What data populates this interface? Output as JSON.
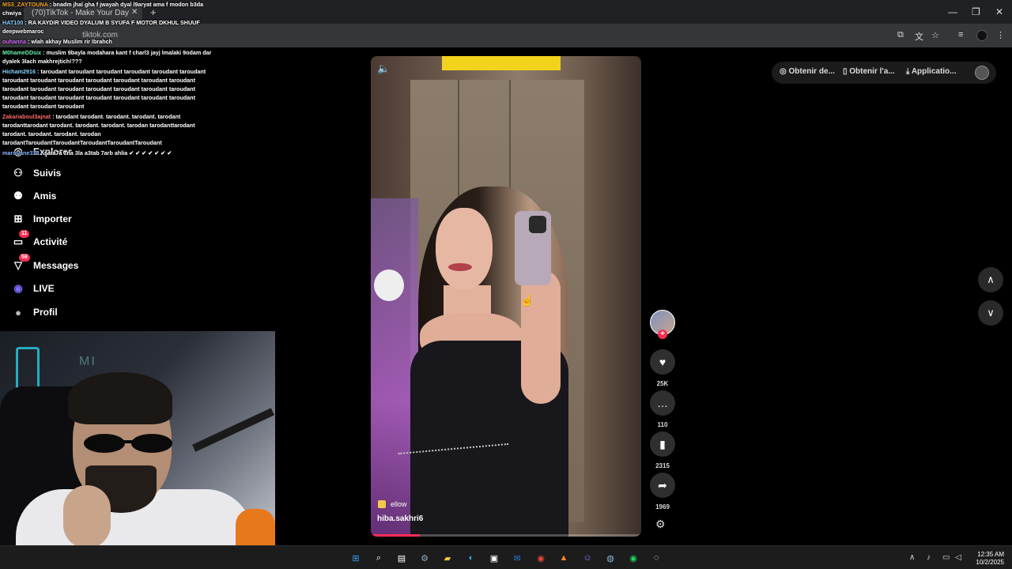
{
  "browser": {
    "tab_title": "(70)TikTok - Make Your Day",
    "tab_close": "✕",
    "new_tab": "+",
    "url": "tiktok.com",
    "win_minimize": "—",
    "win_restore": "❐",
    "win_close": "✕"
  },
  "chat": [
    {
      "user": "MS3_ZAYTOUNA",
      "user_color": "#f5a623",
      "text": "bnadm jhal gha f jwayah dyal l9aryat ama f modon b3da chwiya"
    },
    {
      "user": "HAT100",
      "user_color": "#8ad4ff",
      "text": "RA KAYDIR VIDEO DYALUM B SYUFA F MOTOR DKHUL SHUUF deepwebmaroc"
    },
    {
      "user": "ouhanna",
      "user_color": "#d26bff",
      "text": "wlah akhay Muslim rir Ibrahch"
    },
    {
      "user": "M0hameDDsix",
      "user_color": "#6cf0b0",
      "text": "muslim 9bayla modahara kant f charl3 jayj lmalaki 9odam dar dyalek 3lach makhrejtich!???"
    },
    {
      "user": "Hicham2916",
      "user_color": "#8ad4ff",
      "text": "taroudant taroudant taroudant taroudant taroudant taroudant taroudant taroudant taroudant taroudant taroudant taroudant taroudant taroudant taroudant taroudant taroudant taroudant taroudant taroudant taroudant taroudant taroudant taroudant taroudant taroudant taroudant taroudant taroudant taroudant"
    },
    {
      "user": "Zakariaboul3ajnat",
      "user_color": "#ff6b6b",
      "text": "tarodant tarodant. tarodant. tarodant. tarodant tarodanttarodant tarodant. tarodant. tarodant. tarodan tarodanttarodant tarodant. tarodant. tarodant. tarodan tarodantTaroudantTaroudantTaroudantTaroudantTaroudant"
    },
    {
      "user": "marouane338",
      "user_color": "#8ab4ff",
      "text": "sara7a 7na 3la a3tab 7arb ahlia ✔ ✔ ✔ ✔ ✔ ✔ ✔"
    }
  ],
  "sidebar": {
    "items": [
      {
        "label": "Explorer",
        "icon": "compass-icon",
        "glyph": "◎"
      },
      {
        "label": "Suivis",
        "icon": "following-icon",
        "glyph": "⚇"
      },
      {
        "label": "Amis",
        "icon": "friends-icon",
        "glyph": "⚉"
      },
      {
        "label": "Importer",
        "icon": "upload-icon",
        "glyph": "⊞"
      },
      {
        "label": "Activité",
        "icon": "activity-icon",
        "glyph": "▭",
        "badge": "11"
      },
      {
        "label": "Messages",
        "icon": "messages-icon",
        "glyph": "▽",
        "badge": "59"
      },
      {
        "label": "LIVE",
        "icon": "live-icon",
        "glyph": "◉"
      },
      {
        "label": "Profil",
        "icon": "profile-icon",
        "glyph": "●"
      }
    ]
  },
  "webcam": {
    "sign": "MI"
  },
  "top_actions": {
    "get_desktop": "Obtenir de...",
    "get_app": "Obtenir l'a...",
    "application": "Applicatio..."
  },
  "video": {
    "music": "ellow",
    "author": "hiba.sakhri6",
    "volume_glyph": "🔈",
    "progress": 0.18
  },
  "actions": {
    "like": {
      "glyph": "♥",
      "count": "25K"
    },
    "comment": {
      "glyph": "…",
      "count": "110"
    },
    "save": {
      "glyph": "▮",
      "count": "2315"
    },
    "share": {
      "glyph": "➦",
      "count": "1969"
    },
    "follow_plus": "+"
  },
  "nav_arrows": {
    "up": "∧",
    "down": "∨"
  },
  "taskbar": {
    "time": "12:35 AM",
    "date": "10/2/2025"
  },
  "colors": {
    "accent": "#fe2c55",
    "background": "#000000"
  }
}
